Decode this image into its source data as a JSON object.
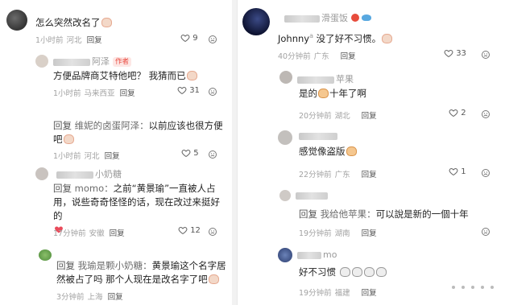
{
  "left": {
    "comments": [
      {
        "text": "怎么突然改名了",
        "time": "1小时前",
        "location": "河北",
        "reply_label": "回复",
        "likes": "9"
      },
      {
        "author_tag": "作者",
        "name_suffix": "阿泽",
        "text": "方便品牌商艾特他吧？ 我猜而已",
        "time": "1小时前",
        "location": "马来西亚",
        "reply_label": "回复",
        "likes": "31"
      },
      {
        "reply_prefix": "回复",
        "reply_to": "维妮的卤蛋阿泽：",
        "text_line1": "以前应该也很方便",
        "text_line2": "吧",
        "time": "1小时前",
        "location": "河北",
        "reply_label": "回复",
        "likes": "5"
      },
      {
        "name_suffix": "小奶糖",
        "reply_prefix": "回复",
        "reply_to": "momo：",
        "text_line1": "之前“黄景瑜”一直被人占",
        "text_line2": "用，说些奇奇怪怪的话，现在改过来挺好的",
        "time": "17分钟前",
        "location": "安徽",
        "reply_label": "回复",
        "likes": "12"
      },
      {
        "reply_prefix": "回复",
        "reply_to": "我瑜是颗小奶糖：",
        "text_line1": "黄景瑜这个名字居",
        "text_line2": "然被占了吗 那个人现在是改名字了吧",
        "time": "3分钟前",
        "location": "上海",
        "reply_label": "回复"
      }
    ]
  },
  "right": {
    "comments": [
      {
        "name_suffix": "滑蛋饭",
        "text_prefix": "Johnny",
        "text": "没了好不习惯。",
        "time": "40分钟前",
        "location": "广东",
        "reply_label": "回复",
        "likes": "33"
      },
      {
        "name_suffix": "苹果",
        "text_pre": "是的",
        "text_post": "十年了啊",
        "time": "20分钟前",
        "location": "湖北",
        "reply_label": "回复",
        "likes": "2"
      },
      {
        "text": "感觉像盗版",
        "time": "22分钟前",
        "location": "广东",
        "reply_label": "回复",
        "likes": "1"
      },
      {
        "reply_prefix": "回复",
        "reply_to": "我给他苹果：",
        "text": "可以說是新的一個十年",
        "time": "19分钟前",
        "location": "湖南",
        "reply_label": "回复"
      },
      {
        "name_suffix": "mo",
        "text": "好不习惯",
        "time": "19分钟前",
        "location": "福建",
        "reply_label": "回复"
      }
    ]
  }
}
